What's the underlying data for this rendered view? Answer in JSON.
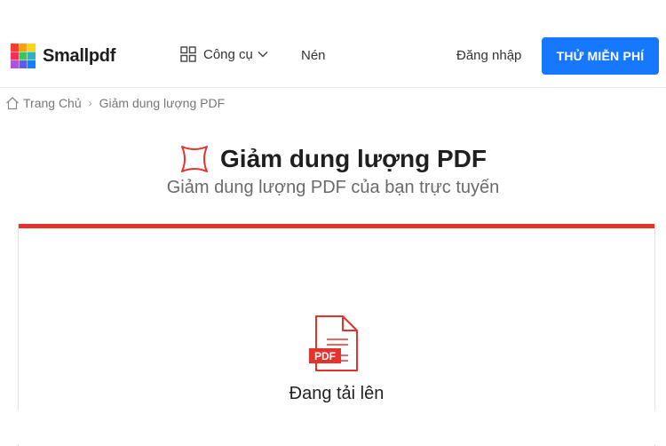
{
  "app": {
    "brand": "Smallpdf"
  },
  "header": {
    "tools_label": "Công cụ",
    "compress_label": "Nén",
    "login_label": "Đăng nhập",
    "cta_label": "THỬ MIỄN PHÍ"
  },
  "breadcrumb": {
    "home": "Trang Chủ",
    "separator": "›",
    "current": "Giảm dung lượng PDF"
  },
  "tool": {
    "title": "Giảm dung lượng PDF",
    "subtitle": "Giảm dung lượng PDF của bạn trực tuyến",
    "file_badge": "PDF",
    "status": "Đang tải lên",
    "accent_color": "#e5322d"
  },
  "colors": {
    "cta": "#1677ff",
    "accent": "#e5322d"
  },
  "icons": [
    "smallpdf-logo-icon",
    "grid-icon",
    "chevron-down-icon",
    "home-icon",
    "compress-icon",
    "pdf-file-icon"
  ]
}
